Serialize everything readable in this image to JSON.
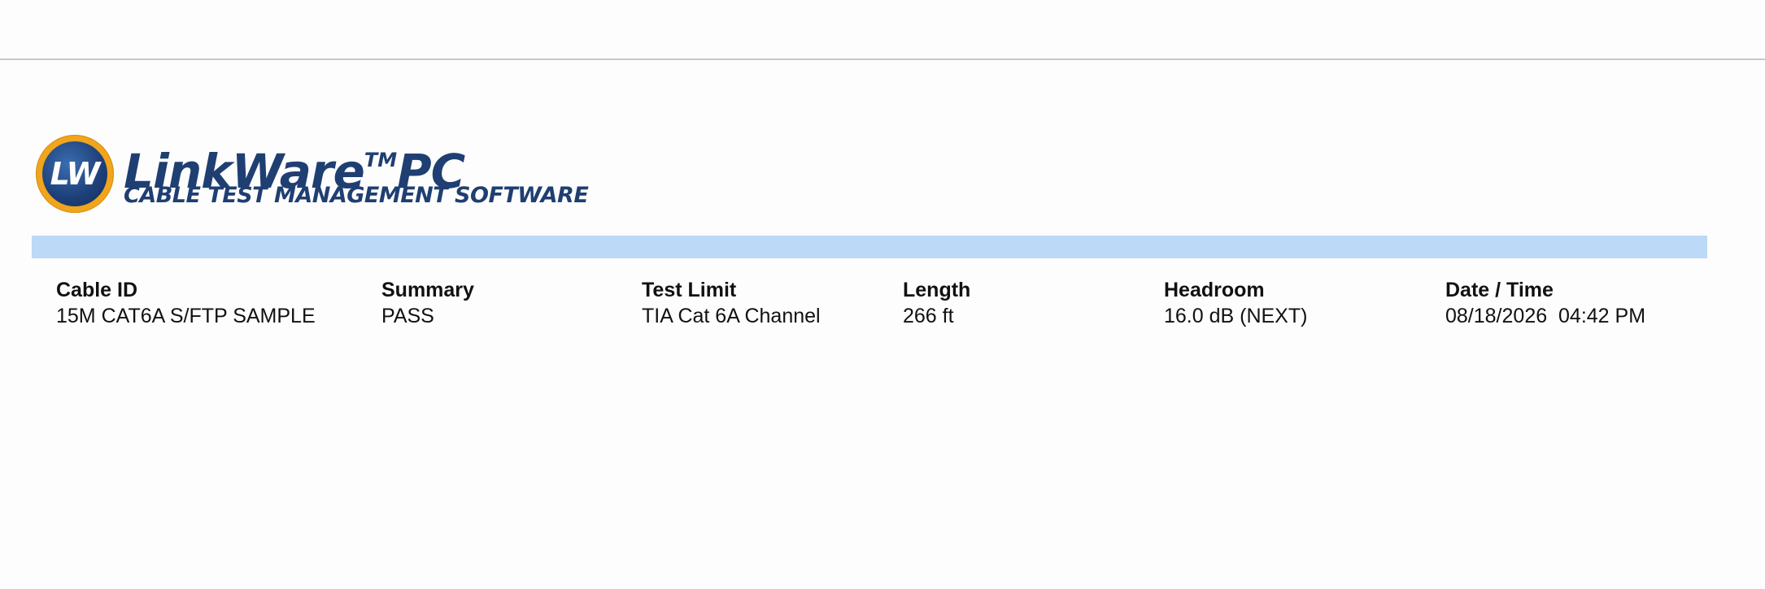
{
  "logo": {
    "badge": "LW",
    "title": "LinkWare",
    "trademark": "TM",
    "title_suffix": "PC",
    "subtitle": "CABLE TEST MANAGEMENT SOFTWARE"
  },
  "summary": {
    "columns": [
      {
        "label": "Cable ID",
        "value": "15M CAT6A S/FTP SAMPLE"
      },
      {
        "label": "Summary",
        "value": "PASS"
      },
      {
        "label": "Test Limit",
        "value": "TIA Cat 6A Channel"
      },
      {
        "label": "Length",
        "value": "266 ft"
      },
      {
        "label": "Headroom",
        "value": "16.0 dB (NEXT)"
      },
      {
        "label": "Date / Time",
        "value": "08/18/2026  04:42 PM"
      }
    ]
  },
  "colors": {
    "brand_navy": "#1f3f72",
    "brand_orange": "#f0a51c",
    "band_blue": "#bcd9f7"
  }
}
